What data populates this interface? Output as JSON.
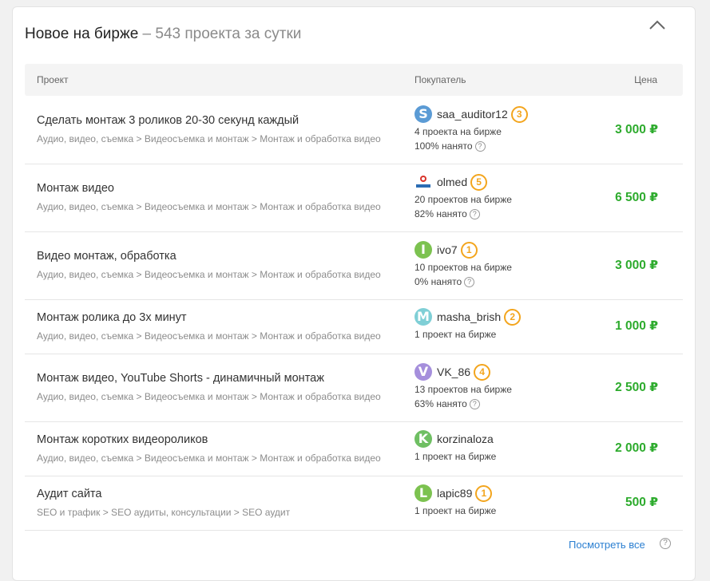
{
  "header": {
    "title": "Новое на бирже",
    "subtitle": " – 543 проекта за сутки"
  },
  "table": {
    "col_project": "Проект",
    "col_buyer": "Покупатель",
    "col_price": "Цена"
  },
  "rows": [
    {
      "title": "Сделать монтаж 3 роликов 20-30 секунд каждый",
      "category": "Аудио, видео, съемка > Видеосъемка и монтаж > Монтаж и обработка видео",
      "buyer": "saa_auditor12",
      "avatar_letter": "S",
      "avatar_color": "#5b9bd5",
      "level": "3",
      "projects": "4 проекта на бирже",
      "hired": "100% нанято",
      "price": "3 000 ₽"
    },
    {
      "title": "Монтаж видео",
      "category": "Аудио, видео, съемка > Видеосъемка и монтаж > Монтаж и обработка видео",
      "buyer": "olmed",
      "avatar_letter": "",
      "avatar_color": "logo",
      "level": "5",
      "projects": "20 проектов на бирже",
      "hired": "82% нанято",
      "price": "6 500 ₽"
    },
    {
      "title": "Видео монтаж, обработка",
      "category": "Аудио, видео, съемка > Видеосъемка и монтаж > Монтаж и обработка видео",
      "buyer": "ivo7",
      "avatar_letter": "I",
      "avatar_color": "#7cc250",
      "level": "1",
      "projects": "10 проектов на бирже",
      "hired": "0% нанято",
      "price": "3 000 ₽"
    },
    {
      "title": "Монтаж ролика до 3х минут",
      "category": "Аудио, видео, съемка > Видеосъемка и монтаж > Монтаж и обработка видео",
      "buyer": "masha_brish",
      "avatar_letter": "M",
      "avatar_color": "#7fcfd6",
      "level": "2",
      "projects": "1 проект на бирже",
      "hired": "",
      "price": "1 000 ₽"
    },
    {
      "title": "Монтаж видео, YouTube Shorts - динамичный монтаж",
      "category": "Аудио, видео, съемка > Видеосъемка и монтаж > Монтаж и обработка видео",
      "buyer": "VK_86",
      "avatar_letter": "V",
      "avatar_color": "#a58fdc",
      "level": "4",
      "projects": "13 проектов на бирже",
      "hired": "63% нанято",
      "price": "2 500 ₽"
    },
    {
      "title": "Монтаж коротких видеороликов",
      "category": "Аудио, видео, съемка > Видеосъемка и монтаж > Монтаж и обработка видео",
      "buyer": "korzinaloza",
      "avatar_letter": "K",
      "avatar_color": "#6fbf63",
      "level": "",
      "projects": "1 проект на бирже",
      "hired": "",
      "price": "2 000 ₽"
    },
    {
      "title": "Аудит сайта",
      "category": "SEO и трафик > SEO аудиты, консультации > SEO аудит",
      "buyer": "lapic89",
      "avatar_letter": "L",
      "avatar_color": "#7cc250",
      "level": "1",
      "projects": "1 проект на бирже",
      "hired": "",
      "price": "500 ₽"
    }
  ],
  "footer": {
    "see_all": "Посмотреть все"
  }
}
